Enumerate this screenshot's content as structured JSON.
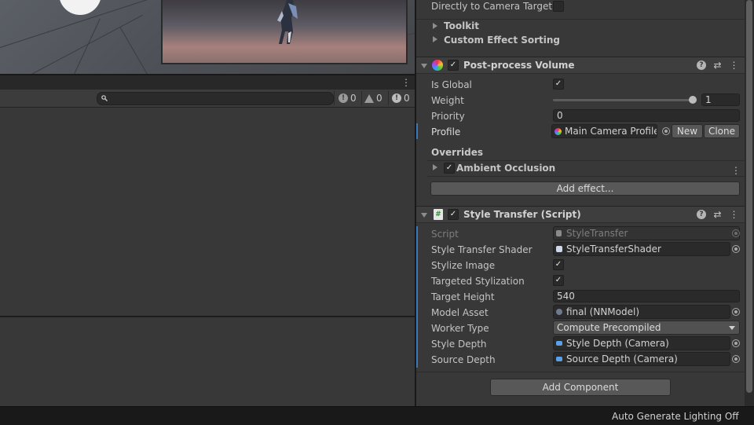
{
  "console": {
    "counts": {
      "logs": "0",
      "warnings": "0",
      "errors": "0"
    },
    "search_placeholder": ""
  },
  "inspector": {
    "camera_target_row": {
      "label": "Directly to Camera Target",
      "checked": false
    },
    "toolkit_label": "Toolkit",
    "custom_sorting_label": "Custom Effect Sorting",
    "ppv": {
      "title": "Post-process Volume",
      "is_global_label": "Is Global",
      "is_global": true,
      "weight_label": "Weight",
      "weight_value": "1",
      "weight_fraction": 1.0,
      "priority_label": "Priority",
      "priority_value": "0",
      "profile_label": "Profile",
      "profile_value": "Main Camera Profile",
      "new_label": "New",
      "clone_label": "Clone",
      "overrides_label": "Overrides",
      "ao_label": "Ambient Occlusion",
      "add_effect_label": "Add effect..."
    },
    "style_transfer": {
      "title": "Style Transfer (Script)",
      "rows": {
        "script_label": "Script",
        "script_value": "StyleTransfer",
        "shader_label": "Style Transfer Shader",
        "shader_value": "StyleTransferShader",
        "stylize_label": "Stylize Image",
        "targeted_label": "Targeted Stylization",
        "height_label": "Target Height",
        "height_value": "540",
        "model_label": "Model Asset",
        "model_value": "final (NNModel)",
        "worker_label": "Worker Type",
        "worker_value": "Compute Precompiled",
        "style_depth_label": "Style Depth",
        "style_depth_value": "Style Depth (Camera)",
        "source_depth_label": "Source Depth",
        "source_depth_value": "Source Depth (Camera)"
      }
    },
    "add_component_label": "Add Component"
  },
  "statusbar": {
    "text": "Auto Generate Lighting Off"
  },
  "colors": {
    "accent": "#3a79bb",
    "panel": "#383838",
    "header": "#3e3e3e"
  }
}
